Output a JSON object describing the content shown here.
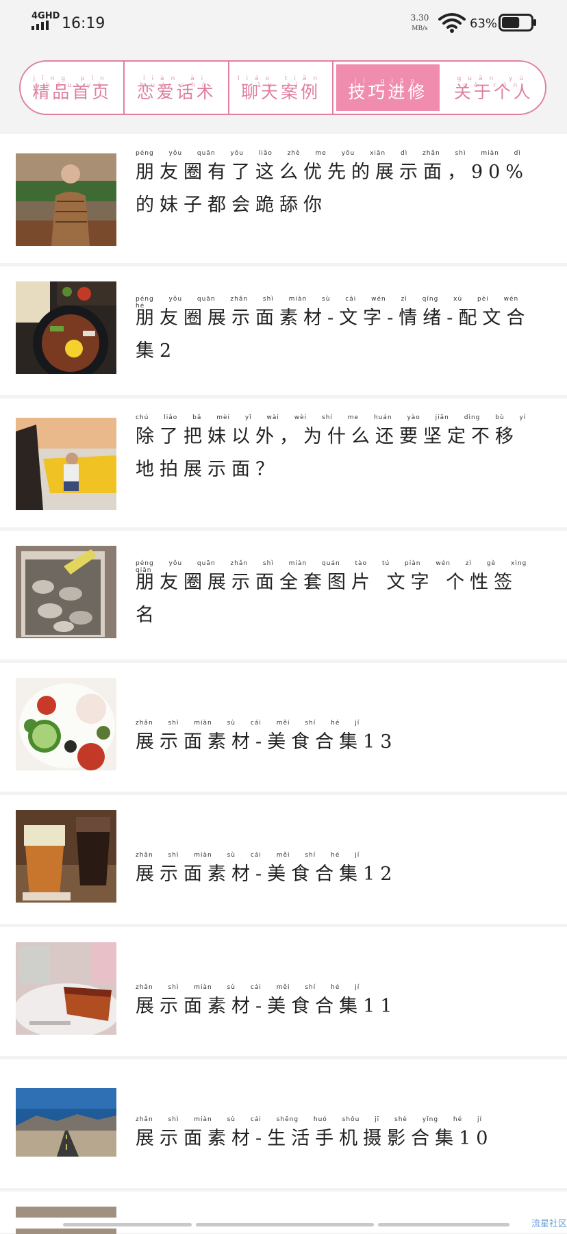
{
  "status_bar": {
    "network": "4GHD",
    "time": "16:19",
    "speed_value": "3.30",
    "speed_unit": "MB/s",
    "battery_pct": "63%",
    "battery_level": 0.63
  },
  "tabs": [
    {
      "label": "精品首页",
      "pinyin": "jīng pǐn shǒu yè",
      "active": false
    },
    {
      "label": "恋爱话术",
      "pinyin": "liàn ài huà shù",
      "active": false
    },
    {
      "label": "聊天案例",
      "pinyin": "liáo tiān àn lì",
      "active": false
    },
    {
      "label": "技巧进修",
      "pinyin": "jì qiǎo jìn xiū",
      "active": true
    },
    {
      "label": "关于个人",
      "pinyin": "guān yú gè rén",
      "active": false
    }
  ],
  "articles": [
    {
      "title": "朋友圈有了这么优先的展示面，90%的妹子都会跪舔你",
      "pinyin": "péng yǒu quān yǒu liǎo zhè me yōu xiān dì zhǎn shì miàn dì"
    },
    {
      "title": "朋友圈展示面素材-文字-情绪-配文合集2",
      "pinyin": "péng yǒu quān zhǎn shì miàn sù cái wén zì qíng xù pèi wén hé"
    },
    {
      "title": "除了把妹以外，为什么还要坚定不移地拍展示面？",
      "pinyin": "chú liǎo bǎ mèi yǐ wài wèi shí me huán yào jiān dìng bù yí"
    },
    {
      "title": "朋友圈展示面全套图片 文字 个性签名",
      "pinyin": "péng yǒu quān zhǎn shì miàn quán tào tú piàn wén zì gè xìng qiān"
    },
    {
      "title": "展示面素材-美食合集13",
      "pinyin": "zhǎn shì miàn sù cái měi shí hé jí"
    },
    {
      "title": "展示面素材-美食合集12",
      "pinyin": "zhǎn shì miàn sù cái měi shí hé jí"
    },
    {
      "title": "展示面素材-美食合集11",
      "pinyin": "zhǎn shì miàn sù cái měi shí hé jí"
    },
    {
      "title": "展示面素材-生活手机摄影合集10",
      "pinyin": "zhǎn shì miàn sù cái shēng huó shǒu jī shè yǐng hé jí"
    }
  ],
  "watermark": "流星社区",
  "colors": {
    "accent": "#f08cad",
    "accent_border": "#e07fa0",
    "background": "#f3f3f3"
  }
}
